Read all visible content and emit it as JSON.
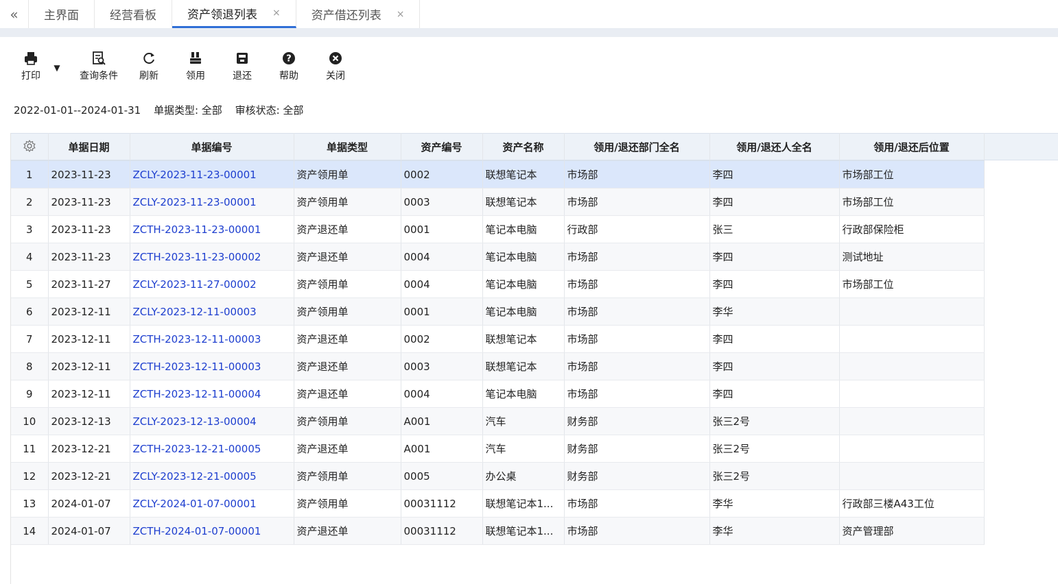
{
  "tabs": {
    "collapse": "«",
    "items": [
      {
        "label": "主界面",
        "closable": false
      },
      {
        "label": "经营看板",
        "closable": false
      },
      {
        "label": "资产领退列表",
        "closable": true,
        "active": true
      },
      {
        "label": "资产借还列表",
        "closable": true
      }
    ],
    "close_glyph": "×"
  },
  "toolbar": {
    "print": "打印",
    "query": "查询条件",
    "refresh": "刷新",
    "receive": "领用",
    "return": "退还",
    "help": "帮助",
    "close": "关闭"
  },
  "filter": {
    "date_range": "2022-01-01--2024-01-31",
    "doc_type": "单据类型: 全部",
    "audit_status": "审核状态: 全部"
  },
  "table": {
    "columns": [
      "单据日期",
      "单据编号",
      "单据类型",
      "资产编号",
      "资产名称",
      "领用/退还部门全名",
      "领用/退还人全名",
      "领用/退还后位置"
    ],
    "rows": [
      {
        "n": "1",
        "date": "2023-11-23",
        "no": "ZCLY-2023-11-23-00001",
        "type": "资产领用单",
        "asset_no": "0002",
        "asset_name": "联想笔记本",
        "dept": "市场部",
        "person": "李四",
        "location": "市场部工位"
      },
      {
        "n": "2",
        "date": "2023-11-23",
        "no": "ZCLY-2023-11-23-00001",
        "type": "资产领用单",
        "asset_no": "0003",
        "asset_name": "联想笔记本",
        "dept": "市场部",
        "person": "李四",
        "location": "市场部工位"
      },
      {
        "n": "3",
        "date": "2023-11-23",
        "no": "ZCTH-2023-11-23-00001",
        "type": "资产退还单",
        "asset_no": "0001",
        "asset_name": "笔记本电脑",
        "dept": "行政部",
        "person": "张三",
        "location": "行政部保险柜"
      },
      {
        "n": "4",
        "date": "2023-11-23",
        "no": "ZCTH-2023-11-23-00002",
        "type": "资产退还单",
        "asset_no": "0004",
        "asset_name": "笔记本电脑",
        "dept": "市场部",
        "person": "李四",
        "location": "测试地址"
      },
      {
        "n": "5",
        "date": "2023-11-27",
        "no": "ZCLY-2023-11-27-00002",
        "type": "资产领用单",
        "asset_no": "0004",
        "asset_name": "笔记本电脑",
        "dept": "市场部",
        "person": "李四",
        "location": "市场部工位"
      },
      {
        "n": "6",
        "date": "2023-12-11",
        "no": "ZCLY-2023-12-11-00003",
        "type": "资产领用单",
        "asset_no": "0001",
        "asset_name": "笔记本电脑",
        "dept": "市场部",
        "person": "李华",
        "location": ""
      },
      {
        "n": "7",
        "date": "2023-12-11",
        "no": "ZCTH-2023-12-11-00003",
        "type": "资产退还单",
        "asset_no": "0002",
        "asset_name": "联想笔记本",
        "dept": "市场部",
        "person": "李四",
        "location": ""
      },
      {
        "n": "8",
        "date": "2023-12-11",
        "no": "ZCTH-2023-12-11-00003",
        "type": "资产退还单",
        "asset_no": "0003",
        "asset_name": "联想笔记本",
        "dept": "市场部",
        "person": "李四",
        "location": ""
      },
      {
        "n": "9",
        "date": "2023-12-11",
        "no": "ZCTH-2023-12-11-00004",
        "type": "资产退还单",
        "asset_no": "0004",
        "asset_name": "笔记本电脑",
        "dept": "市场部",
        "person": "李四",
        "location": ""
      },
      {
        "n": "10",
        "date": "2023-12-13",
        "no": "ZCLY-2023-12-13-00004",
        "type": "资产领用单",
        "asset_no": "A001",
        "asset_name": "汽车",
        "dept": "财务部",
        "person": "张三2号",
        "location": ""
      },
      {
        "n": "11",
        "date": "2023-12-21",
        "no": "ZCTH-2023-12-21-00005",
        "type": "资产退还单",
        "asset_no": "A001",
        "asset_name": "汽车",
        "dept": "财务部",
        "person": "张三2号",
        "location": ""
      },
      {
        "n": "12",
        "date": "2023-12-21",
        "no": "ZCLY-2023-12-21-00005",
        "type": "资产领用单",
        "asset_no": "0005",
        "asset_name": "办公桌",
        "dept": "财务部",
        "person": "张三2号",
        "location": ""
      },
      {
        "n": "13",
        "date": "2024-01-07",
        "no": "ZCLY-2024-01-07-00001",
        "type": "资产领用单",
        "asset_no": "00031112",
        "asset_name": "联想笔记本1...",
        "dept": "市场部",
        "person": "李华",
        "location": "行政部三楼A43工位"
      },
      {
        "n": "14",
        "date": "2024-01-07",
        "no": "ZCTH-2024-01-07-00001",
        "type": "资产退还单",
        "asset_no": "00031112",
        "asset_name": "联想笔记本1...",
        "dept": "市场部",
        "person": "李华",
        "location": "资产管理部"
      }
    ]
  }
}
